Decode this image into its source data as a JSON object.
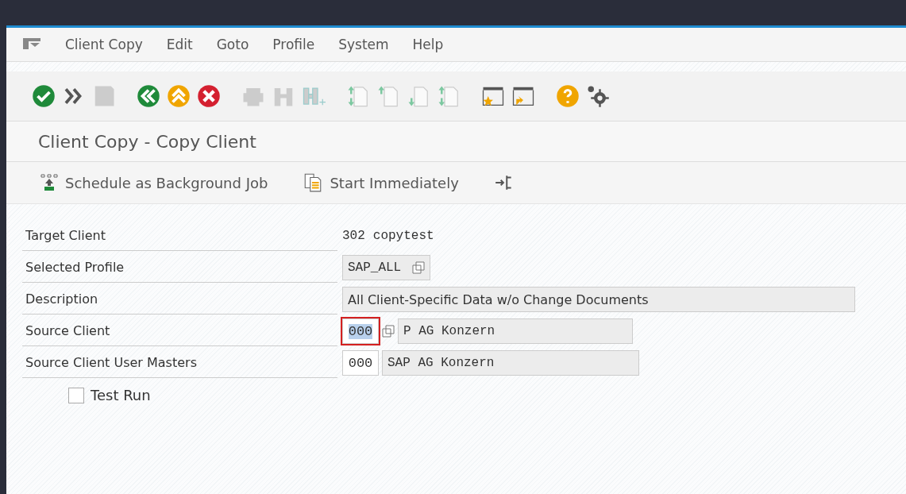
{
  "menu_bar": {
    "items": [
      {
        "label": "Client Copy"
      },
      {
        "label": "Edit"
      },
      {
        "label": "Goto"
      },
      {
        "label": "Profile"
      },
      {
        "label": "System"
      },
      {
        "label": "Help"
      }
    ]
  },
  "title": "Client Copy - Copy Client",
  "app_toolbar": {
    "buttons": [
      {
        "kind": "background-job",
        "label": "Schedule as Background Job"
      },
      {
        "kind": "start",
        "label": "Start Immediately"
      },
      {
        "kind": "expand"
      }
    ]
  },
  "form": {
    "rows": [
      {
        "label": "Target Client",
        "kind": "plain",
        "code": "302",
        "text": "copytest"
      },
      {
        "label": "Selected Profile",
        "kind": "profile",
        "value": "SAP_ALL"
      },
      {
        "label": "Description",
        "kind": "description",
        "value": "All Client-Specific Data w/o Change Documents"
      },
      {
        "label": "Source Client",
        "kind": "client",
        "value": "000",
        "focused": true,
        "text": "P AG Konzern"
      },
      {
        "label": "Source Client User Masters",
        "kind": "client",
        "value": "000",
        "focused": false,
        "text": "SAP AG Konzern"
      }
    ]
  },
  "test_run": {
    "label": "Test Run",
    "checked": false
  }
}
